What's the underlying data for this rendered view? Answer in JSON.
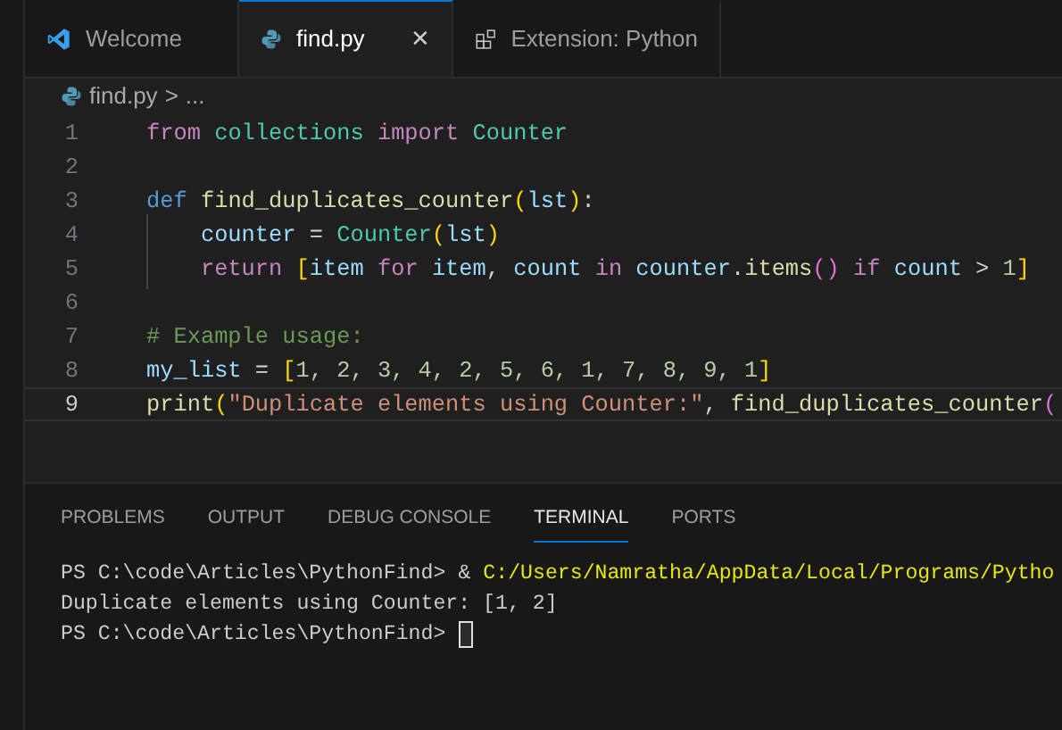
{
  "tabs": [
    {
      "label": "Welcome",
      "selected": false
    },
    {
      "label": "find.py",
      "selected": true
    },
    {
      "label": "Extension: Python",
      "selected": false
    }
  ],
  "close_glyph": "✕",
  "breadcrumb": {
    "file": "find.py",
    "separator": ">",
    "rest": "..."
  },
  "editor": {
    "lines": [
      {
        "number": "1",
        "current": false,
        "tokens": [
          {
            "kind": "keyword",
            "text": "from "
          },
          {
            "kind": "class",
            "text": "collections "
          },
          {
            "kind": "keyword",
            "text": "import "
          },
          {
            "kind": "class",
            "text": "Counter"
          }
        ]
      },
      {
        "number": "2",
        "current": false
      },
      {
        "number": "3",
        "current": false,
        "tokens": [
          {
            "kind": "storage",
            "text": "def "
          },
          {
            "kind": "func",
            "text": "find_duplicates_counter"
          },
          {
            "kind": "bracket1",
            "text": "("
          },
          {
            "kind": "var",
            "text": "lst"
          },
          {
            "kind": "bracket1",
            "text": ")"
          },
          {
            "kind": "plain",
            "text": ":"
          }
        ]
      },
      {
        "number": "4",
        "current": false,
        "tokens": [
          {
            "kind": "var",
            "text": "    counter"
          },
          {
            "kind": "plain",
            "text": " = "
          },
          {
            "kind": "class",
            "text": "Counter"
          },
          {
            "kind": "bracket1",
            "text": "("
          },
          {
            "kind": "var",
            "text": "lst"
          },
          {
            "kind": "bracket1",
            "text": ")"
          }
        ]
      },
      {
        "number": "5",
        "current": false,
        "tokens": [
          {
            "kind": "keyword",
            "text": "    return "
          },
          {
            "kind": "bracket1",
            "text": "["
          },
          {
            "kind": "var",
            "text": "item "
          },
          {
            "kind": "keyword",
            "text": "for "
          },
          {
            "kind": "var",
            "text": "item"
          },
          {
            "kind": "plain",
            "text": ", "
          },
          {
            "kind": "var",
            "text": "count "
          },
          {
            "kind": "keyword",
            "text": "in "
          },
          {
            "kind": "var",
            "text": "counter"
          },
          {
            "kind": "plain",
            "text": "."
          },
          {
            "kind": "func",
            "text": "items"
          },
          {
            "kind": "bracket2",
            "text": "() "
          },
          {
            "kind": "keyword",
            "text": "if "
          },
          {
            "kind": "var",
            "text": "count"
          },
          {
            "kind": "plain",
            "text": " > "
          },
          {
            "kind": "number",
            "text": "1"
          },
          {
            "kind": "bracket1",
            "text": "]"
          }
        ]
      },
      {
        "number": "6",
        "current": false
      },
      {
        "number": "7",
        "current": false,
        "tokens": [
          {
            "kind": "comment",
            "text": "# Example usage:"
          }
        ]
      },
      {
        "number": "8",
        "current": false,
        "tokens": [
          {
            "kind": "var",
            "text": "my_list"
          },
          {
            "kind": "plain",
            "text": " = "
          },
          {
            "kind": "bracket1",
            "text": "["
          },
          {
            "kind": "number",
            "text": "1, 2, 3, 4, 2, 5, 6, 1, 7, 8, 9, 1"
          },
          {
            "kind": "bracket1",
            "text": "]"
          }
        ]
      },
      {
        "number": "9",
        "current": true,
        "tokens": [
          {
            "kind": "func",
            "text": "print"
          },
          {
            "kind": "bracket1",
            "text": "("
          },
          {
            "kind": "string",
            "text": "\"Duplicate elements using Counter:\""
          },
          {
            "kind": "plain",
            "text": ", "
          },
          {
            "kind": "func",
            "text": "find_duplicates_counter"
          },
          {
            "kind": "bracket2",
            "text": "("
          }
        ]
      }
    ]
  },
  "panel": {
    "tabs": [
      {
        "label": "PROBLEMS",
        "selected": false
      },
      {
        "label": "OUTPUT",
        "selected": false
      },
      {
        "label": "DEBUG CONSOLE",
        "selected": false
      },
      {
        "label": "TERMINAL",
        "selected": true
      },
      {
        "label": "PORTS",
        "selected": false
      }
    ],
    "terminal": {
      "lines": [
        {
          "prompt": "PS C:\\code\\Articles\\PythonFind>",
          "parts": [
            {
              "kind": "plain",
              "text": "&"
            },
            {
              "kind": "path",
              "text": "C:/Users/Namratha/AppData/Local/Programs/Pytho"
            }
          ]
        },
        {
          "output": "Duplicate elements using Counter: [1, 2]"
        },
        {
          "prompt": "PS C:\\code\\Articles\\PythonFind>"
        }
      ]
    }
  }
}
